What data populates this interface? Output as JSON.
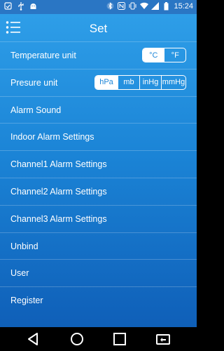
{
  "status_bar": {
    "time": "15:24",
    "battery": "",
    "left_icons": [
      "notification-icon",
      "usb-icon",
      "android-debug-icon"
    ],
    "right_icons": [
      "bluetooth-icon",
      "nfc-icon",
      "vibrate-icon",
      "wifi-icon",
      "signal-icon",
      "battery-icon"
    ]
  },
  "app_bar": {
    "title": "Set",
    "menu_icon": "menu-icon"
  },
  "settings": {
    "temperature": {
      "label": "Temperature unit",
      "options": [
        "°C",
        "°F"
      ],
      "selected": "°C"
    },
    "pressure": {
      "label": "Presure unit",
      "options": [
        "hPa",
        "mb",
        "inHg",
        "mmHg"
      ],
      "selected": "hPa"
    },
    "items": [
      "Alarm Sound",
      "Indoor Alarm Settings",
      "Channel1 Alarm Settings",
      "Channel2 Alarm Settings",
      "Channel3 Alarm Settings",
      "Unbind",
      "User",
      "Register"
    ]
  },
  "nav_bar": {
    "icons": [
      "back-icon",
      "home-icon",
      "recents-icon",
      "screen-mirror-icon"
    ]
  },
  "colors": {
    "accent": "#1d86d8",
    "status_bar": "#2a76c4",
    "gradient_top": "#2e9ee8",
    "gradient_bottom": "#0f5fb8"
  }
}
